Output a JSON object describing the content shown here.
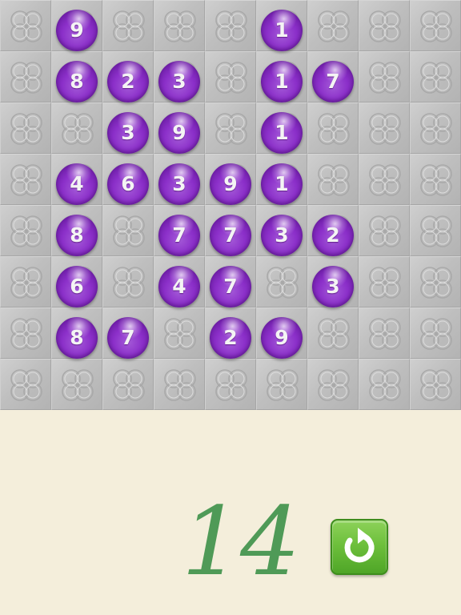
{
  "game": {
    "score": "14",
    "restart_icon": "restart-icon",
    "ball_color": "#8b2fc9",
    "score_color": "#4f9a57",
    "restart_button_color": "#6ec03c"
  },
  "grid": {
    "rows": 8,
    "cols": 9
  },
  "balls": [
    {
      "row": 0,
      "col": 1,
      "value": "9"
    },
    {
      "row": 0,
      "col": 5,
      "value": "1"
    },
    {
      "row": 1,
      "col": 1,
      "value": "8"
    },
    {
      "row": 1,
      "col": 2,
      "value": "2"
    },
    {
      "row": 1,
      "col": 3,
      "value": "3"
    },
    {
      "row": 1,
      "col": 5,
      "value": "1"
    },
    {
      "row": 1,
      "col": 6,
      "value": "7"
    },
    {
      "row": 2,
      "col": 2,
      "value": "3"
    },
    {
      "row": 2,
      "col": 3,
      "value": "9"
    },
    {
      "row": 2,
      "col": 5,
      "value": "1"
    },
    {
      "row": 3,
      "col": 1,
      "value": "4"
    },
    {
      "row": 3,
      "col": 2,
      "value": "6"
    },
    {
      "row": 3,
      "col": 3,
      "value": "3"
    },
    {
      "row": 3,
      "col": 4,
      "value": "9"
    },
    {
      "row": 3,
      "col": 5,
      "value": "1"
    },
    {
      "row": 4,
      "col": 1,
      "value": "8"
    },
    {
      "row": 4,
      "col": 3,
      "value": "7"
    },
    {
      "row": 4,
      "col": 4,
      "value": "7"
    },
    {
      "row": 4,
      "col": 5,
      "value": "3"
    },
    {
      "row": 4,
      "col": 6,
      "value": "2"
    },
    {
      "row": 5,
      "col": 1,
      "value": "6"
    },
    {
      "row": 5,
      "col": 3,
      "value": "4"
    },
    {
      "row": 5,
      "col": 4,
      "value": "7"
    },
    {
      "row": 5,
      "col": 6,
      "value": "3"
    },
    {
      "row": 6,
      "col": 1,
      "value": "8"
    },
    {
      "row": 6,
      "col": 2,
      "value": "7"
    },
    {
      "row": 6,
      "col": 4,
      "value": "2"
    },
    {
      "row": 6,
      "col": 5,
      "value": "9"
    }
  ]
}
